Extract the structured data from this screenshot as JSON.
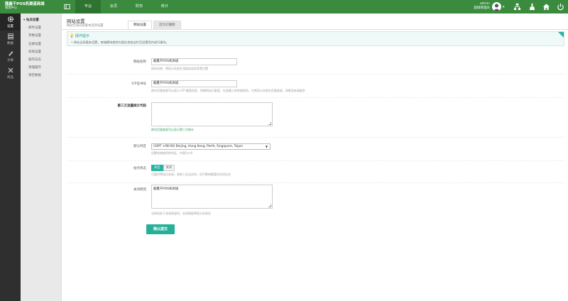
{
  "brand": {
    "title": "龍鑫干POS机渠道商城",
    "subtitle": "管理中心"
  },
  "nav": [
    {
      "label": "平台",
      "active": true
    },
    {
      "label": "会员",
      "active": false
    },
    {
      "label": "财务",
      "active": false
    },
    {
      "label": "统计",
      "active": false
    }
  ],
  "user": {
    "name": "admin",
    "role": "超级管理员"
  },
  "left_nav": [
    {
      "label": "设置",
      "icon": "gear-icon"
    },
    {
      "label": "数据",
      "icon": "database-icon"
    },
    {
      "label": "文章",
      "icon": "pen-icon"
    },
    {
      "label": "商品",
      "icon": "tools-icon"
    }
  ],
  "sub_nav": [
    "站点设置",
    "邮件设置",
    "参数设置",
    "注册设置",
    "权限设置",
    "操作日志",
    "清理缓存",
    "清空数据"
  ],
  "page": {
    "title": "网站设置",
    "subtitle": "网站全局内容基本选项设置"
  },
  "tabs": [
    "网站设置",
    "首页幻播图"
  ],
  "tip": {
    "title": "操作提示",
    "body": "网站全局基本设置，商城模块相关内容在其各自栏目设置项内进行操作。"
  },
  "form": {
    "site_name": {
      "label": "网站名称",
      "value": "龍鑫干POS机商城",
      "help": "网站名称，将显示在前台顶部欢迎信息等位置"
    },
    "icp": {
      "label": "ICP证书号",
      "value": "龍鑫干POS机商城",
      "help": "前台页面底部可以显示 ICP 备案信息，如果网站已备案，在此输入你的授权码，它将显示在前台页面底部，如果没有请留空"
    },
    "stats": {
      "label": "第三方流量统计代码",
      "value": "",
      "help": "前台页面底部可以显示第三方统计"
    },
    "timezone": {
      "label": "默认时区",
      "value": "(GMT +08:00) Beijing, Hong Kong, Perth, Singapore, Taipei",
      "help": "设置系统使用的时区，中国为+8"
    },
    "status": {
      "label": "站点状态",
      "on": "开启",
      "off": "关闭",
      "help": "可暂时将站点关闭，其他人无法访问，但不影响管理员访问后台"
    },
    "close_reason": {
      "label": "关闭原因",
      "value": "龍鑫干POS机商城",
      "help": "当网站处于关闭状态时，关闭原因将显示在前台"
    }
  },
  "submit": "确认提交"
}
